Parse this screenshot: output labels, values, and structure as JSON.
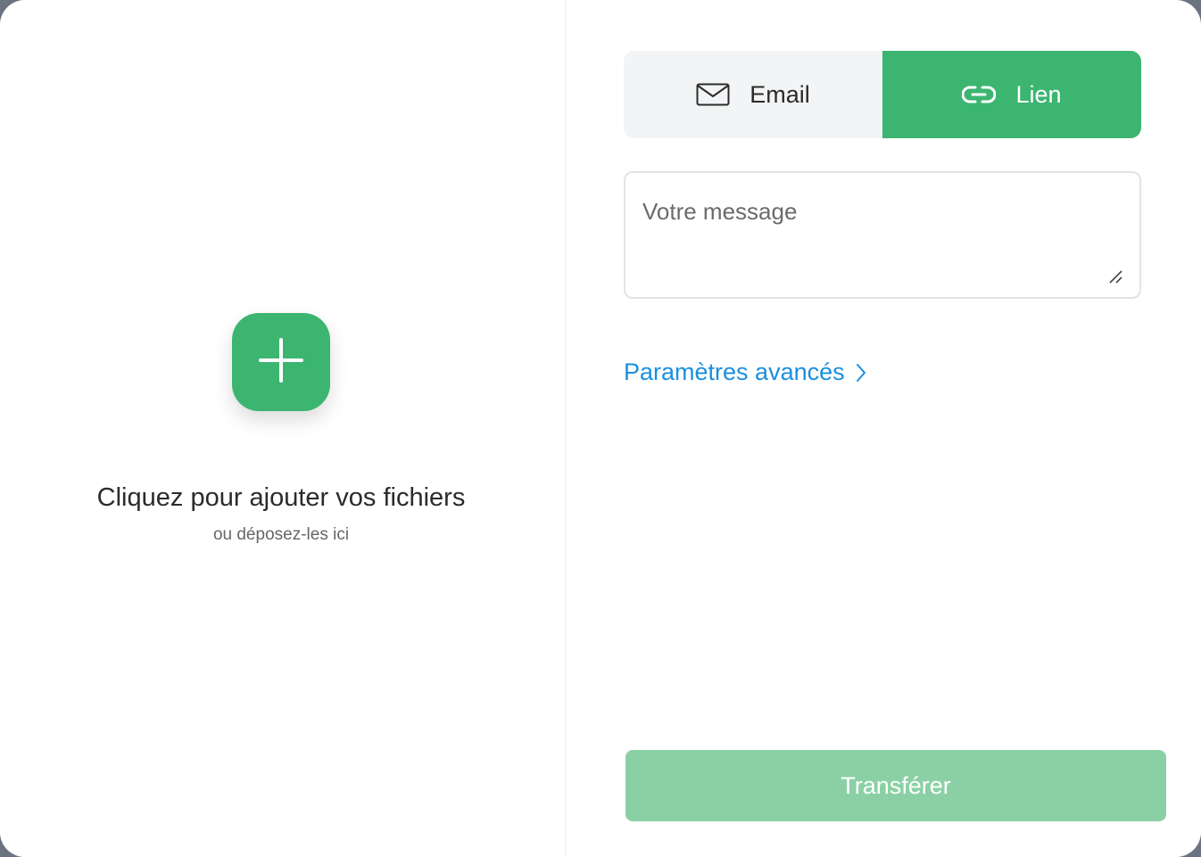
{
  "upload": {
    "icon": "plus-icon",
    "title": "Cliquez pour ajouter vos fichiers",
    "subtitle": "ou déposez-les ici"
  },
  "tabs": [
    {
      "label": "Email",
      "icon": "envelope-icon",
      "active": false
    },
    {
      "label": "Lien",
      "icon": "link-icon",
      "active": true
    }
  ],
  "message": {
    "placeholder": "Votre message",
    "value": ""
  },
  "advanced": {
    "label": "Paramètres avancés",
    "icon": "chevron-right-icon"
  },
  "transfer": {
    "label": "Transférer",
    "enabled": false
  },
  "colors": {
    "accent_green": "#3cb571",
    "disabled_green": "#8bd0a4",
    "link_blue": "#1a8fdf",
    "tab_inactive_bg": "#f3f4f6"
  }
}
